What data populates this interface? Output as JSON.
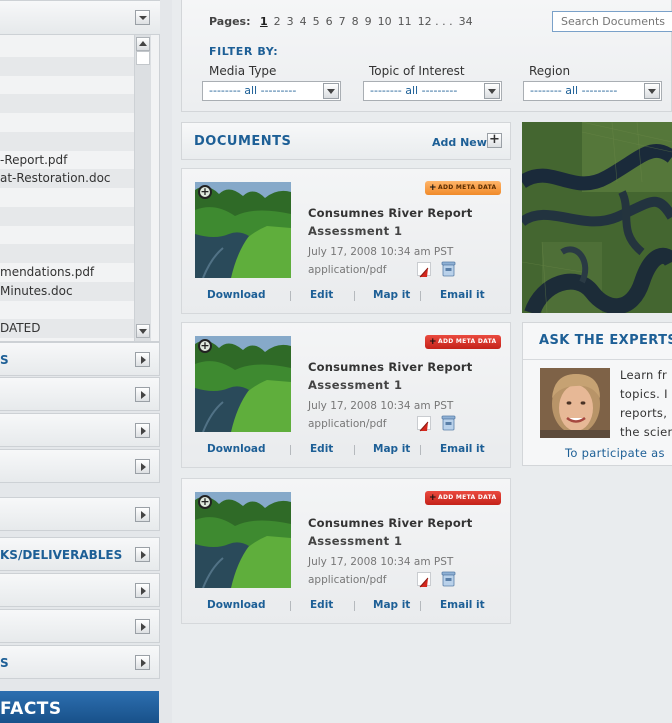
{
  "sidebar": {
    "list_items": [
      {
        "label": "",
        "alt": false
      },
      {
        "label": "",
        "alt": true
      },
      {
        "label": "",
        "alt": false
      },
      {
        "label": "",
        "alt": true
      },
      {
        "label": "",
        "alt": false
      },
      {
        "label": "",
        "alt": true
      },
      {
        "label": "-Report.pdf",
        "alt": false
      },
      {
        "label": "at-Restoration.doc",
        "alt": true
      },
      {
        "label": "",
        "alt": false
      },
      {
        "label": "",
        "alt": true
      },
      {
        "label": "",
        "alt": false
      },
      {
        "label": "",
        "alt": true
      },
      {
        "label": "mendations.pdf",
        "alt": false
      },
      {
        "label": "Minutes.doc",
        "alt": true
      },
      {
        "label": "",
        "alt": false
      },
      {
        "label": "DATED",
        "alt": true
      }
    ],
    "sections": [
      {
        "label": "S",
        "name": "sidebar-section-1"
      },
      {
        "label": "",
        "name": "sidebar-section-2"
      },
      {
        "label": "",
        "name": "sidebar-section-3"
      },
      {
        "label": "",
        "name": "sidebar-section-4"
      },
      {
        "label": "",
        "name": "sidebar-section-5"
      },
      {
        "label": "KS/DELIVERABLES",
        "name": "sidebar-section-deliverables"
      },
      {
        "label": "",
        "name": "sidebar-section-7"
      },
      {
        "label": "",
        "name": "sidebar-section-8"
      },
      {
        "label": "S",
        "name": "sidebar-section-9"
      }
    ],
    "facts_label": "FACTS"
  },
  "pagination": {
    "label": "Pages:",
    "pages": [
      "1",
      "2",
      "3",
      "4",
      "5",
      "6",
      "7",
      "8",
      "9",
      "10",
      "11",
      "12 . . .",
      "34"
    ],
    "current": "1"
  },
  "search": {
    "placeholder": "Search Documents"
  },
  "filter": {
    "heading": "FILTER BY:",
    "fields": [
      {
        "label": "Media Type",
        "value": "-------- all ---------"
      },
      {
        "label": "Topic of Interest",
        "value": "-------- all ---------"
      },
      {
        "label": "Region",
        "value": "-------- all ---------"
      }
    ]
  },
  "documents": {
    "title": "DOCUMENTS",
    "add_new_label": "Add New",
    "add_plus": "+",
    "meta_label": "ADD META DATA",
    "actions": [
      "Download",
      "Edit",
      "Map it",
      "Email it"
    ],
    "items": [
      {
        "title": "Consumnes River Report",
        "subtitle": "Assessment 1",
        "date": "July 17, 2008   10:34 am PST",
        "type": "application/pdf",
        "meta_color": "#f5963d"
      },
      {
        "title": "Consumnes River Report",
        "subtitle": "Assessment 1",
        "date": "July 17, 2008   10:34 am PST",
        "type": "application/pdf",
        "meta_color": "#d4281e"
      },
      {
        "title": "Consumnes River Report",
        "subtitle": "Assessment 1",
        "date": "July 17, 2008   10:34 am PST",
        "type": "application/pdf",
        "meta_color": "#d4281e"
      }
    ]
  },
  "experts": {
    "title": "ASK THE EXPERTS",
    "lines": [
      "Learn fr",
      "topics.  I",
      "reports,",
      "the scien"
    ],
    "cta": "To participate as"
  },
  "colors": {
    "accent": "#1d5f96",
    "meta_orange": "#f5963d",
    "meta_red": "#d4281e",
    "facts_blue": "#1f5f9f"
  }
}
